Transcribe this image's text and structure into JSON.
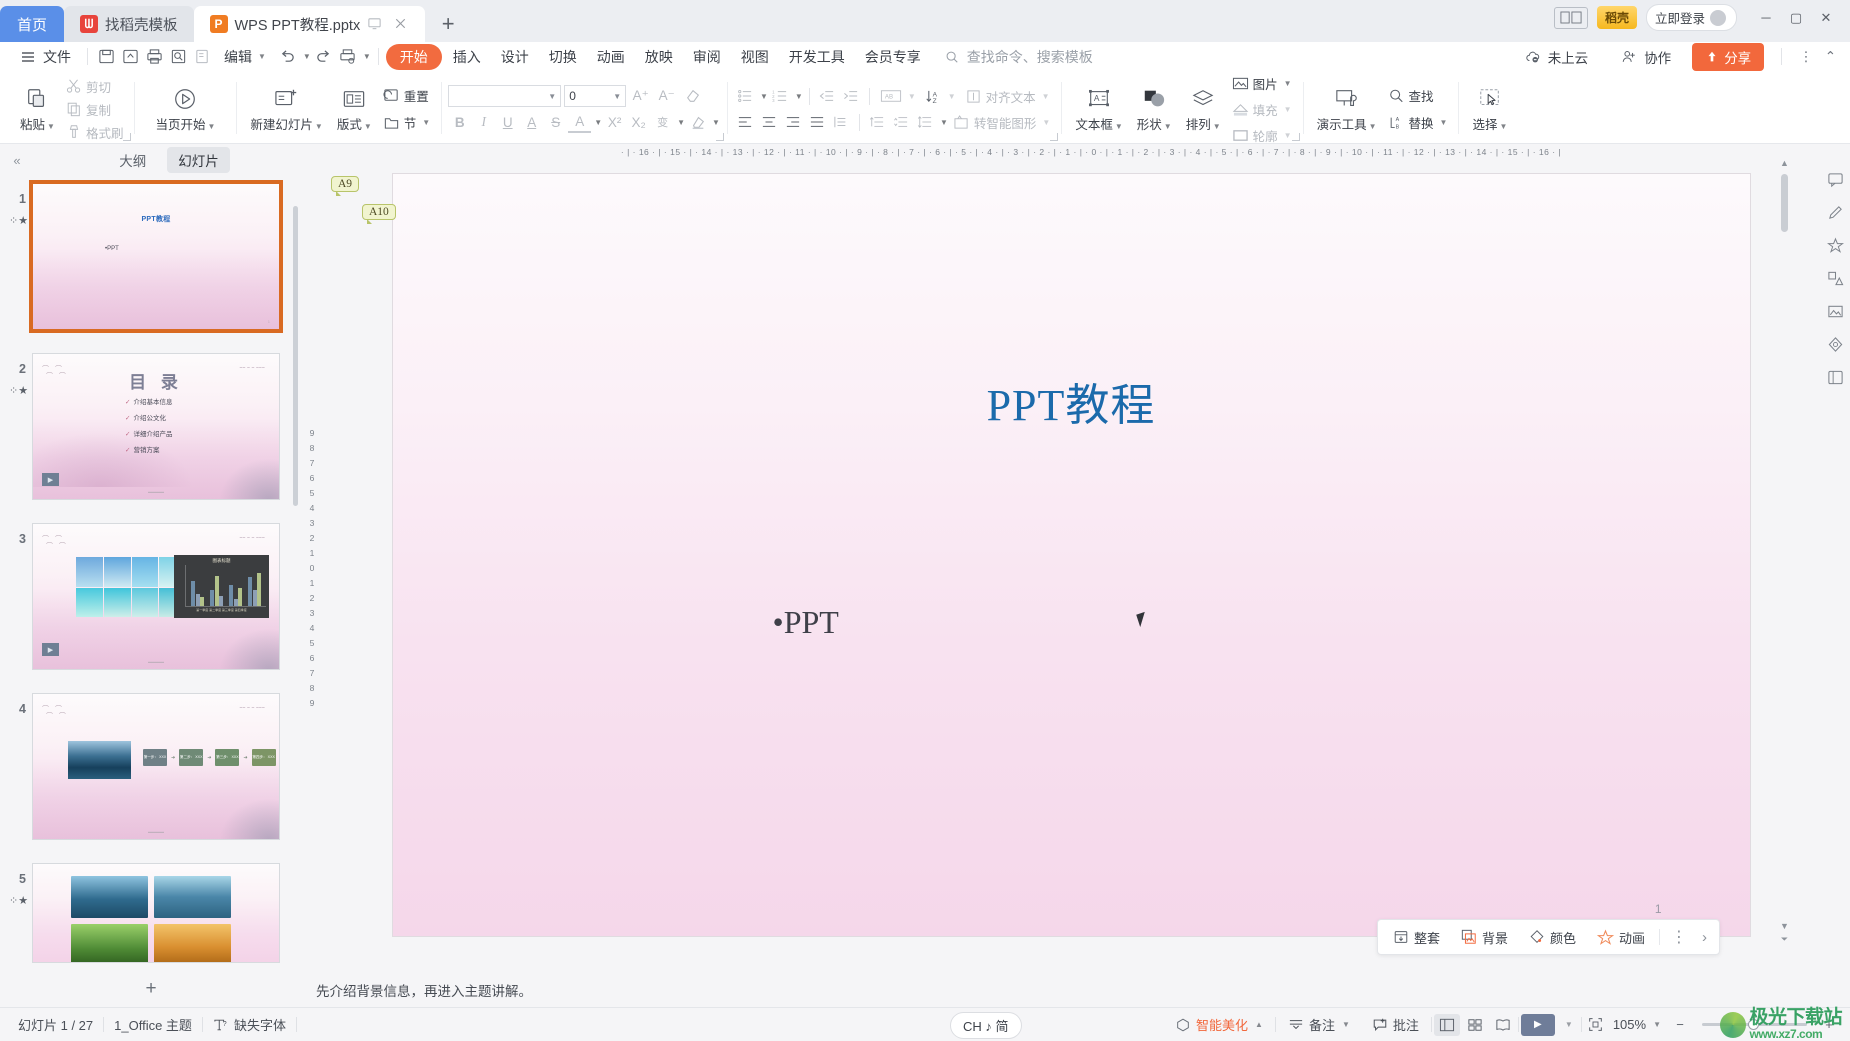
{
  "window": {
    "tabs": [
      {
        "label": "首页",
        "icon": "home-tab",
        "type": "home"
      },
      {
        "label": "找稻壳模板",
        "icon": "docer-icon",
        "type": "inactive"
      },
      {
        "label": "WPS PPT教程.pptx",
        "icon": "ppt-file-icon",
        "type": "active"
      }
    ],
    "new_tab_label": "+",
    "screen_badge": "⿻",
    "vip_label": "稻壳",
    "login_label": "立即登录",
    "controls": {
      "minimize": "─",
      "maximize": "▢",
      "close": "✕"
    }
  },
  "menubar": {
    "file_label": "文件",
    "quick_icons": [
      "save-icon",
      "save-as-cloud-icon",
      "print-icon",
      "print-preview-icon",
      "edit-doc-icon"
    ],
    "edit_label": "编辑",
    "undo_label": "↶",
    "redo_label": "↷",
    "print_quick_label": "🖶",
    "more_label": "▾",
    "tabs": [
      "开始",
      "插入",
      "设计",
      "切换",
      "动画",
      "放映",
      "审阅",
      "视图",
      "开发工具",
      "会员专享"
    ],
    "active_tab": "开始",
    "search_placeholder": "查找命令、搜索模板",
    "cloud_label": "未上云",
    "collab_label": "协作",
    "share_label": "分享",
    "more_dots": "⋮",
    "collapse": "⌃"
  },
  "ribbon": {
    "groups": [
      {
        "name": "clipboard",
        "big": [
          {
            "label": "粘贴",
            "icon": "paste-icon",
            "dropdown": true
          }
        ],
        "small": [
          {
            "label": "剪切",
            "icon": "cut-icon",
            "enabled": false
          },
          {
            "label": "复制",
            "icon": "copy-icon",
            "enabled": false
          },
          {
            "label": "格式刷",
            "icon": "format-painter-icon",
            "enabled": false
          }
        ]
      },
      {
        "name": "slideshow",
        "big": [
          {
            "label": "当页开始",
            "icon": "play-circle-icon",
            "dropdown": true
          }
        ]
      },
      {
        "name": "slides",
        "big": [
          {
            "label": "新建幻灯片",
            "icon": "new-slide-icon",
            "dropdown": true
          },
          {
            "label": "版式",
            "icon": "layout-icon",
            "dropdown": true
          }
        ],
        "small": [
          {
            "label": "重置",
            "icon": "reset-icon",
            "enabled": true
          },
          {
            "label": "节",
            "icon": "section-icon",
            "enabled": true
          }
        ]
      },
      {
        "name": "font",
        "font_name": "",
        "font_size": "0",
        "grow_label": "A⁺",
        "shrink_label": "A⁻",
        "clear_label": "clear-format-icon",
        "bold": "B",
        "italic": "I",
        "underline": "U",
        "strike_a": "A",
        "strike_s": "S",
        "text_color": "A",
        "superscript": "X²",
        "subscript": "X₂",
        "pinyin": "变",
        "highlight": "highlighter-icon"
      },
      {
        "name": "paragraph",
        "bullets": "bullet-list-icon",
        "numbering": "numbered-list-icon",
        "indent_dec": "decrease-indent-icon",
        "indent_inc": "increase-indent-icon",
        "align_left": "align-left-icon",
        "align_center": "align-center-icon",
        "align_right": "align-right-icon",
        "align_justify": "align-justify-icon",
        "distribute": "distribute-icon",
        "text_dir_label": "AB",
        "sort_label": "↓A",
        "align_text_label": "对齐文本",
        "line_space_labels": [
          "↑≡",
          "≠≡",
          "↕≡"
        ],
        "smartart_label": "转智能图形"
      },
      {
        "name": "insert",
        "big": [
          {
            "label": "文本框",
            "icon": "text-box-icon",
            "dropdown": true
          },
          {
            "label": "形状",
            "icon": "shapes-icon",
            "dropdown": true
          },
          {
            "label": "排列",
            "icon": "arrange-icon",
            "dropdown": true
          }
        ],
        "small": [
          {
            "label": "图片",
            "icon": "picture-icon",
            "enabled": true
          },
          {
            "label": "填充",
            "icon": "fill-icon",
            "enabled": false
          },
          {
            "label": "轮廓",
            "icon": "outline-icon",
            "enabled": false
          }
        ]
      },
      {
        "name": "tools",
        "big": [
          {
            "label": "演示工具",
            "icon": "presentation-tools-icon",
            "dropdown": true
          }
        ],
        "small": [
          {
            "label": "查找",
            "icon": "search-icon",
            "enabled": true
          },
          {
            "label": "替换",
            "icon": "replace-icon",
            "enabled": true
          }
        ]
      },
      {
        "name": "select",
        "big": [
          {
            "label": "选择",
            "icon": "select-icon",
            "dropdown": true
          }
        ]
      }
    ]
  },
  "thumbpanel": {
    "collapse_icon": "«",
    "tabs": [
      {
        "label": "大纲",
        "selected": false
      },
      {
        "label": "幻灯片",
        "selected": true
      }
    ],
    "add_slide_label": "+",
    "slides": [
      {
        "number": "1",
        "active": true,
        "kind": "title",
        "title": "PPT教程",
        "subtitle": "•PPT"
      },
      {
        "number": "2",
        "active": false,
        "kind": "catalog",
        "title": "目 录",
        "items": [
          "介绍基本信息",
          "介绍公文化",
          "详细介绍产品",
          "营销方案"
        ]
      },
      {
        "number": "3",
        "active": false,
        "kind": "photo-chart",
        "chart_title": "图表标题",
        "chart_x": "第一季度 第二季度 第三季度 第四季度"
      },
      {
        "number": "4",
        "active": false,
        "kind": "process",
        "steps": [
          "第一步：\nXXX",
          "第二步：\nXXX",
          "第三步：\nXXX",
          "第四步：\nXXX"
        ]
      },
      {
        "number": "5",
        "active": false,
        "kind": "photos"
      }
    ]
  },
  "ruler": {
    "horizontal": "· | · 16 · | · 15 · | · 14 · | · 13 · | · 12 · | · 11 · | · 10 · | · 9 · | · 8 · | · 7 · | · 6 · | · 5 · | · 4 · | · 3 · | · 2 · | · 1 · | · 0 · | · 1 · | · 2 · | · 3 · | · 4 · | · 5 · | · 6 · | · 7 · | · 8 · | · 9 · | · 10 · | · 11 · | · 12 · | · 13 · | · 14 · | · 15 · | · 16 · |",
    "vertical": [
      "9",
      "8",
      "7",
      "6",
      "5",
      "4",
      "3",
      "2",
      "1",
      "0",
      "1",
      "2",
      "3",
      "4",
      "5",
      "6",
      "7",
      "8",
      "9"
    ]
  },
  "slide_canvas": {
    "title": "PPT教程",
    "subtitle": "•PPT",
    "page_number": "1",
    "animation_tags": [
      "A9",
      "A10"
    ]
  },
  "design_toolbar": {
    "items": [
      {
        "label": "整套",
        "icon": "full-set-icon"
      },
      {
        "label": "背景",
        "icon": "background-icon"
      },
      {
        "label": "颜色",
        "icon": "color-icon"
      },
      {
        "label": "动画",
        "icon": "animation-star-icon"
      }
    ],
    "more_dots": "⋮",
    "expand": "›"
  },
  "right_sidebar": {
    "icons": [
      "feedback-icon",
      "pen-icon",
      "ai-star-icon",
      "shapes-panel-icon",
      "image-panel-icon",
      "diamond-icon",
      "tools-panel-icon"
    ]
  },
  "notes": {
    "text": "先介绍背景信息，再进入主题讲解。"
  },
  "statusbar": {
    "slide_count": "幻灯片 1 / 27",
    "theme": "1_Office 主题",
    "missing_font": "缺失字体",
    "ime": "CH ♪ 简",
    "beautify": "智能美化",
    "notes_label": "备注",
    "comments_label": "批注",
    "views": [
      "normal-view-icon",
      "slide-sorter-icon",
      "reading-view-icon"
    ],
    "active_view": "normal-view-icon",
    "play_label": "▶",
    "fit_label": "⊡",
    "zoom": "105%",
    "zoom_out": "−",
    "zoom_in": "+"
  },
  "watermark": {
    "main": "极光下载站",
    "sub": "www.xz7.com"
  },
  "colors": {
    "accent_orange": "#f2683c",
    "tab_blue": "#5a8fe8",
    "title_blue": "#1b6aab",
    "selected_slide_border": "#d96a22",
    "anim_tag_bg": "#f1f4cf"
  }
}
